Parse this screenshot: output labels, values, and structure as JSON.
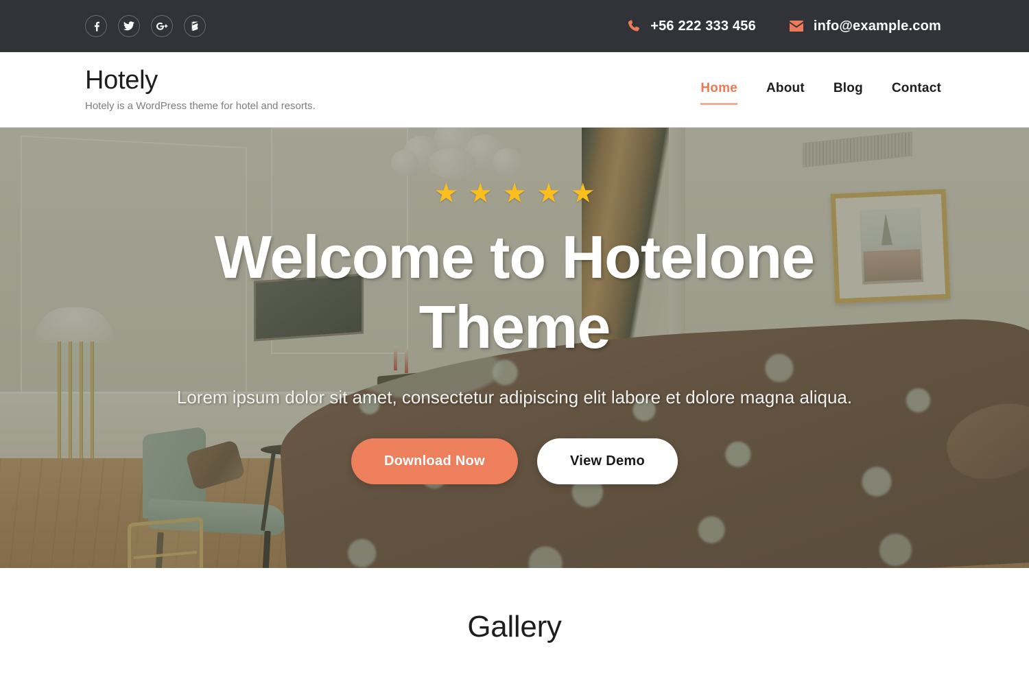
{
  "topbar": {
    "social": [
      {
        "name": "facebook-icon",
        "label": "Facebook"
      },
      {
        "name": "twitter-icon",
        "label": "Twitter"
      },
      {
        "name": "google-plus-icon",
        "label": "Google Plus"
      },
      {
        "name": "houzz-icon",
        "label": "Houzz"
      }
    ],
    "phone": "+56 222 333 456",
    "phone_icon": "phone-icon",
    "email": "info@example.com",
    "email_icon": "envelope-icon",
    "background_color": "#313338",
    "icon_accent_color": "#ed7b5a"
  },
  "header": {
    "site_title": "Hotely",
    "tagline": "Hotely is a WordPress theme for hotel and resorts.",
    "nav": [
      {
        "label": "Home",
        "active": true
      },
      {
        "label": "About",
        "active": false
      },
      {
        "label": "Blog",
        "active": false
      },
      {
        "label": "Contact",
        "active": false
      }
    ],
    "active_color": "#ec7a57",
    "underline_color": "#e9ad99"
  },
  "hero": {
    "rating_stars": 5,
    "star_glyph": "★",
    "star_color": "#fcbe1d",
    "title": "Welcome to Hotelone Theme",
    "subtitle": "Lorem ipsum dolor sit amet, consectetur adipiscing elit labore et dolore magna aliqua.",
    "primary_button": "Download Now",
    "secondary_button": "View Demo",
    "primary_button_color": "#ee7f5c",
    "secondary_button_color": "#ffffff",
    "background_description": "hotel room with chandelier, green bench, writing desk and patterned bed"
  },
  "gallery": {
    "heading": "Gallery"
  }
}
